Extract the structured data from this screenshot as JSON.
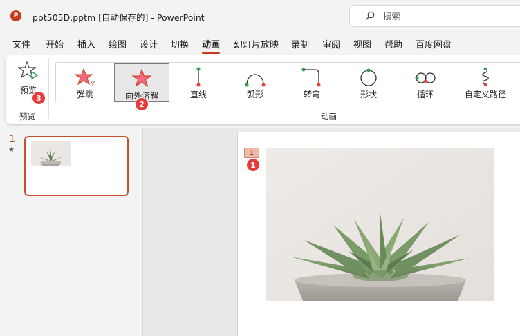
{
  "app": {
    "logo_letter": "P",
    "title": "ppt505D.pptm [自动保存的]  -  PowerPoint"
  },
  "search": {
    "placeholder": "搜索"
  },
  "tabs": [
    {
      "label": "文件"
    },
    {
      "label": "开始"
    },
    {
      "label": "插入"
    },
    {
      "label": "绘图"
    },
    {
      "label": "设计"
    },
    {
      "label": "切换"
    },
    {
      "label": "动画",
      "active": true
    },
    {
      "label": "幻灯片放映"
    },
    {
      "label": "录制"
    },
    {
      "label": "审阅"
    },
    {
      "label": "视图"
    },
    {
      "label": "帮助"
    },
    {
      "label": "百度网盘"
    }
  ],
  "ribbon": {
    "preview": {
      "label": "预览",
      "group_label": "预览"
    },
    "animations": {
      "group_label": "动画",
      "items": [
        {
          "label": "弹跳",
          "icon": "bounce-star-icon"
        },
        {
          "label": "向外溶解",
          "icon": "dissolve-star-icon",
          "selected": true
        },
        {
          "label": "直线",
          "icon": "line-path-icon"
        },
        {
          "label": "弧形",
          "icon": "arc-path-icon"
        },
        {
          "label": "转弯",
          "icon": "turn-path-icon"
        },
        {
          "label": "形状",
          "icon": "shape-path-icon"
        },
        {
          "label": "循环",
          "icon": "loop-path-icon"
        },
        {
          "label": "自定义路径",
          "icon": "custom-path-icon"
        }
      ]
    }
  },
  "badges": {
    "one": "1",
    "two": "2",
    "three": "3"
  },
  "thumbnails": [
    {
      "number": "1",
      "star": "★"
    }
  ],
  "slide": {
    "animation_tag": "1"
  },
  "colors": {
    "accent": "#c43e1c",
    "badge": "#e83b3b",
    "tag": "#f4b6a6"
  }
}
